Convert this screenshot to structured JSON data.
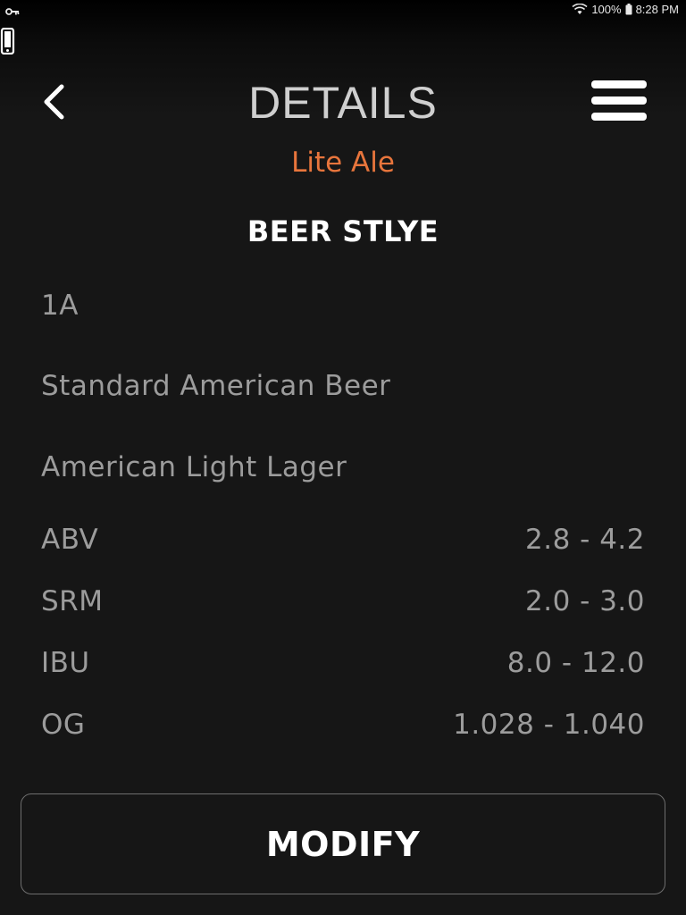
{
  "status_bar": {
    "battery": "100%",
    "time": "8:28 PM",
    "icons": [
      "key-icon",
      "wifi-icon",
      "battery-icon",
      "phone-icon"
    ]
  },
  "header": {
    "title": "DETAILS",
    "subtitle": "Lite Ale",
    "back_icon": "chevron-left-icon",
    "menu_icon": "hamburger-menu-icon"
  },
  "section": {
    "title": "BEER STLYE"
  },
  "style_info": {
    "code": "1A",
    "category": "Standard American Beer",
    "subcategory": "American Light Lager"
  },
  "stats": [
    {
      "label": "ABV",
      "value": "2.8 - 4.2"
    },
    {
      "label": "SRM",
      "value": "2.0 - 3.0"
    },
    {
      "label": "IBU",
      "value": "8.0 - 12.0"
    },
    {
      "label": "OG",
      "value": "1.028 - 1.040"
    }
  ],
  "actions": {
    "modify_label": "MODIFY"
  },
  "colors": {
    "background": "#161616",
    "accent": "#e8753c",
    "muted_text": "#9c9c9c",
    "title_text": "#cfcfcf"
  }
}
